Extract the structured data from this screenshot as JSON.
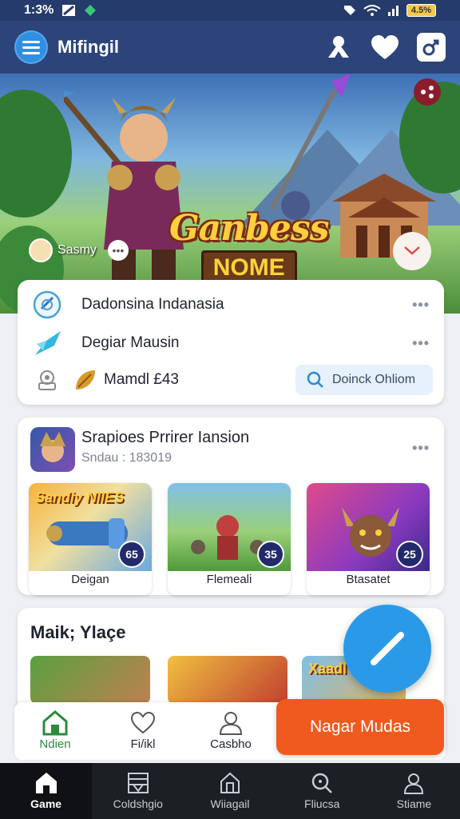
{
  "status_bar": {
    "time": "1:3%",
    "battery": "4.5%"
  },
  "header": {
    "title": "Mifingil"
  },
  "hero": {
    "title_line1": "Ganbess",
    "title_line2": "NOME",
    "user_name": "Sasmy",
    "more": "•••"
  },
  "info": {
    "rows": [
      {
        "label": "Dadonsina Indanasia",
        "icon": "target-icon"
      },
      {
        "label": "Degiar Mausin",
        "icon": "crystal-icon"
      },
      {
        "label": "Mamdl £43",
        "icon": "leaf-icon"
      }
    ],
    "search_label": "Doinck Ohliom",
    "more": "•••"
  },
  "promo": {
    "title": "Srapioes Prrirer Iansion",
    "subtitle": "Sndau : 183019",
    "more": "•••",
    "items": [
      {
        "caption": "Deigan",
        "badge": "65",
        "banner": "Sandiy NIIES"
      },
      {
        "caption": "Flemeali",
        "badge": "35",
        "banner": ""
      },
      {
        "caption": "Btasatet",
        "badge": "25",
        "banner": ""
      }
    ]
  },
  "section2": {
    "title": "Maik; Ylaçe",
    "banner": "Xaadl"
  },
  "action_bar": {
    "items": [
      {
        "label": "Ndien",
        "icon": "home-icon"
      },
      {
        "label": "Fi/ikl",
        "icon": "heart-icon"
      },
      {
        "label": "Casbho",
        "icon": "user-icon"
      }
    ],
    "cta": "Nagar Mudas"
  },
  "bottom_nav": {
    "items": [
      {
        "label": "Game",
        "icon": "home-icon",
        "active": true
      },
      {
        "label": "Coldshgio",
        "icon": "grid-icon"
      },
      {
        "label": "Wiiagail",
        "icon": "house-icon"
      },
      {
        "label": "Fliucsa",
        "icon": "search-icon"
      },
      {
        "label": "Stiame",
        "icon": "user-icon"
      }
    ]
  },
  "colors": {
    "header": "#2c4479",
    "accent": "#2a9ae8",
    "cta": "#f05a1e",
    "nav": "#1c1f24"
  }
}
